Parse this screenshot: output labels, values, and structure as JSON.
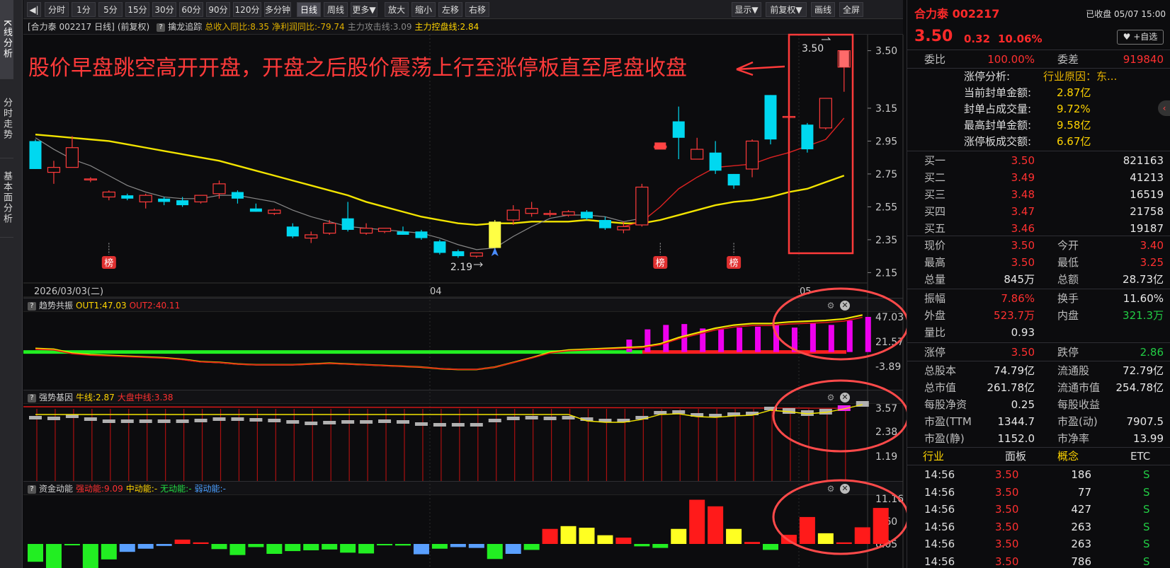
{
  "sidebar": [
    "K线分析",
    "分时走势",
    "基本面分析"
  ],
  "toolbar": {
    "period_buttons": [
      "分时",
      "1分",
      "5分",
      "15分",
      "30分",
      "60分",
      "90分",
      "120分",
      "多分钟",
      "日线",
      "周线",
      "更多▼",
      "放大",
      "缩小",
      "左移",
      "右移"
    ],
    "selected": "日线",
    "right_buttons": [
      "显示▼",
      "前复权▼",
      "画线",
      "全屏"
    ]
  },
  "status": {
    "name": "[合力泰 002217 日线]",
    "adj": "(前复权)",
    "indicator": "擒龙追踪",
    "items": [
      {
        "t": "总收入同比:8.35",
        "c": "#e0b000"
      },
      {
        "t": "净利润同比:-79.74",
        "c": "#e0b000"
      },
      {
        "t": "主力攻击线:3.09",
        "c": "#888888"
      },
      {
        "t": "主力控盘线:2.84",
        "c": "#ffd400"
      }
    ]
  },
  "annotation": "股价早盘跳空高开开盘，开盘之后股价震荡上行至涨停板直至尾盘收盘",
  "main_chart": {
    "y_ticks": [
      "3.50",
      "3.15",
      "2.95",
      "2.75",
      "2.55",
      "2.35",
      "2.15"
    ],
    "date_labels": [
      "2026/03/03(二)",
      "04",
      "05"
    ],
    "high_label": "3.50",
    "low_label": "2.19",
    "badge": "榜"
  },
  "panel1": {
    "name": "趋势共振",
    "items": [
      {
        "t": "OUT1:47.03",
        "c": "#ffd400"
      },
      {
        "t": "OUT2:40.11",
        "c": "#ff3030"
      }
    ],
    "ticks": [
      "47.03",
      "21.57",
      "-3.89"
    ]
  },
  "panel2": {
    "name": "强势基因",
    "items": [
      {
        "t": "牛线:2.87",
        "c": "#ffd400"
      },
      {
        "t": "大盘中线:3.38",
        "c": "#ff3030"
      }
    ],
    "ticks": [
      "3.57",
      "2.38",
      "1.19"
    ]
  },
  "panel3": {
    "name": "资金动能",
    "items": [
      {
        "t": "强动能:9.09",
        "c": "#ff3030"
      },
      {
        "t": "中动能:-",
        "c": "#ffd400"
      },
      {
        "t": "无动能:-",
        "c": "#22dd44"
      },
      {
        "t": "弱动能:-",
        "c": "#4a9fff"
      }
    ],
    "ticks": [
      "11.16",
      "5.60",
      "0.05"
    ]
  },
  "quote": {
    "name": "合力泰 002217",
    "state": "已收盘 05/07 15:00",
    "price": "3.50",
    "change": "0.32",
    "pct": "10.06%",
    "fav": "+自选",
    "weibi_label": "委比",
    "weibi": "100.00%",
    "weicha_label": "委差",
    "weicha": "919840",
    "limit": [
      {
        "l": "涨停分析:",
        "v": "行业原因：东..."
      },
      {
        "l": "当前封单金额:",
        "v": "2.87亿"
      },
      {
        "l": "封单占成交量:",
        "v": "9.72%"
      },
      {
        "l": "最高封单金额:",
        "v": "9.58亿"
      },
      {
        "l": "涨停板成交额:",
        "v": "6.67亿"
      }
    ],
    "bids": [
      {
        "l": "买一",
        "p": "3.50",
        "v": "821163"
      },
      {
        "l": "买二",
        "p": "3.49",
        "v": "41213"
      },
      {
        "l": "买三",
        "p": "3.48",
        "v": "16519"
      },
      {
        "l": "买四",
        "p": "3.47",
        "v": "21758"
      },
      {
        "l": "买五",
        "p": "3.46",
        "v": "19187"
      }
    ],
    "stats1": [
      {
        "l": "现价",
        "v": "3.50",
        "c": "red",
        "l2": "今开",
        "v2": "3.40",
        "c2": "red"
      },
      {
        "l": "最高",
        "v": "3.50",
        "c": "red",
        "l2": "最低",
        "v2": "3.25",
        "c2": "red"
      },
      {
        "l": "总量",
        "v": "845万",
        "c": "white",
        "l2": "总额",
        "v2": "28.73亿",
        "c2": "white"
      }
    ],
    "stats2": [
      {
        "l": "振幅",
        "v": "7.86%",
        "c": "red",
        "l2": "换手",
        "v2": "11.60%",
        "c2": "white"
      },
      {
        "l": "外盘",
        "v": "523.7万",
        "c": "red",
        "l2": "内盘",
        "v2": "321.3万",
        "c2": "green"
      },
      {
        "l": "量比",
        "v": "0.93",
        "c": "white",
        "l2": "",
        "v2": "",
        "c2": "white"
      }
    ],
    "stats3": [
      {
        "l": "涨停",
        "v": "3.50",
        "c": "red",
        "l2": "跌停",
        "v2": "2.86",
        "c2": "green"
      }
    ],
    "stats4": [
      {
        "l": "总股本",
        "v": "74.79亿",
        "c": "white",
        "l2": "流通股",
        "v2": "72.79亿",
        "c2": "white"
      },
      {
        "l": "总市值",
        "v": "261.78亿",
        "c": "white",
        "l2": "流通市值",
        "v2": "254.78亿",
        "c2": "white"
      },
      {
        "l": "每股净资",
        "v": "0.25",
        "c": "white",
        "l2": "每股收益",
        "v2": "",
        "c2": "white"
      },
      {
        "l": "市盈(TTM",
        "v": "1344.7",
        "c": "white",
        "l2": "市盈(动)",
        "v2": "7907.5",
        "c2": "white"
      },
      {
        "l": "市盈(静)",
        "v": "1152.0",
        "c": "white",
        "l2": "市净率",
        "v2": "13.99",
        "c2": "white"
      }
    ],
    "tabs": [
      "行业",
      "面板",
      "概念",
      "ETC"
    ],
    "ticks": [
      {
        "t": "14:56",
        "p": "3.50",
        "v": "186",
        "s": "S"
      },
      {
        "t": "14:56",
        "p": "3.50",
        "v": "77",
        "s": "S"
      },
      {
        "t": "14:56",
        "p": "3.50",
        "v": "427",
        "s": "S"
      },
      {
        "t": "14:56",
        "p": "3.50",
        "v": "263",
        "s": "S"
      },
      {
        "t": "14:56",
        "p": "3.50",
        "v": "263",
        "s": "S"
      },
      {
        "t": "14:56",
        "p": "3.50",
        "v": "786",
        "s": "S"
      }
    ]
  },
  "chart_data": {
    "type": "candlestick",
    "dates_shown": [
      "2026/03/03",
      "04",
      "05"
    ],
    "last_close": 3.5,
    "high_marker": 3.5,
    "low_marker": 2.19,
    "ohlc": [
      [
        2.95,
        2.78,
        2.96,
        2.78
      ],
      [
        2.76,
        2.79,
        2.83,
        2.69
      ],
      [
        2.79,
        2.91,
        2.98,
        2.79
      ],
      [
        2.72,
        2.72,
        2.73,
        2.7
      ],
      [
        2.61,
        2.64,
        2.65,
        2.59
      ],
      [
        2.62,
        2.6,
        2.63,
        2.59
      ],
      [
        2.58,
        2.62,
        2.63,
        2.54
      ],
      [
        2.6,
        2.58,
        2.61,
        2.56
      ],
      [
        2.59,
        2.56,
        2.61,
        2.55
      ],
      [
        2.58,
        2.62,
        2.62,
        2.57
      ],
      [
        2.63,
        2.69,
        2.71,
        2.6
      ],
      [
        2.64,
        2.6,
        2.65,
        2.57
      ],
      [
        2.54,
        2.52,
        2.57,
        2.52
      ],
      [
        2.51,
        2.53,
        2.54,
        2.5
      ],
      [
        2.43,
        2.37,
        2.45,
        2.36
      ],
      [
        2.36,
        2.38,
        2.4,
        2.33
      ],
      [
        2.39,
        2.45,
        2.47,
        2.38
      ],
      [
        2.48,
        2.41,
        2.58,
        2.4
      ],
      [
        2.39,
        2.42,
        2.45,
        2.38
      ],
      [
        2.4,
        2.42,
        2.42,
        2.39
      ],
      [
        2.4,
        2.38,
        2.43,
        2.38
      ],
      [
        2.4,
        2.36,
        2.41,
        2.35
      ],
      [
        2.34,
        2.27,
        2.35,
        2.26
      ],
      [
        2.28,
        2.25,
        2.29,
        2.24
      ],
      [
        2.25,
        2.27,
        2.27,
        2.24
      ],
      [
        2.46,
        2.3,
        2.47,
        2.29
      ],
      [
        2.47,
        2.53,
        2.56,
        2.44
      ],
      [
        2.51,
        2.54,
        2.58,
        2.49
      ],
      [
        2.51,
        2.51,
        2.53,
        2.49
      ],
      [
        2.5,
        2.52,
        2.53,
        2.49
      ],
      [
        2.52,
        2.48,
        2.53,
        2.47
      ],
      [
        2.47,
        2.42,
        2.49,
        2.41
      ],
      [
        2.41,
        2.43,
        2.46,
        2.39
      ],
      [
        2.44,
        2.67,
        2.69,
        2.43
      ],
      [
        2.91,
        2.92,
        2.92,
        2.9
      ],
      [
        3.07,
        2.97,
        3.16,
        2.84
      ],
      [
        2.84,
        2.9,
        2.97,
        2.84
      ],
      [
        2.88,
        2.77,
        2.95,
        2.75
      ],
      [
        2.75,
        2.68,
        2.75,
        2.66
      ],
      [
        2.78,
        2.95,
        2.96,
        2.73
      ],
      [
        3.23,
        2.96,
        3.23,
        2.93
      ],
      [
        3.1,
        3.1,
        3.1,
        3.1
      ],
      [
        3.05,
        2.9,
        3.06,
        2.88
      ],
      [
        3.03,
        3.21,
        3.21,
        3.02
      ],
      [
        3.4,
        3.5,
        3.5,
        3.25
      ]
    ],
    "panel1_bars": [
      21.5,
      33,
      38,
      39,
      34,
      33,
      35,
      36,
      38,
      35,
      40,
      38,
      43,
      47.03
    ],
    "panel3_values": [
      -4.5,
      -6.2,
      -0.2,
      -6.3,
      -3.9,
      -2,
      -1.2,
      -0.5,
      1.1,
      0.4,
      -1.3,
      -2.8,
      -0.8,
      -2.5,
      -1.8,
      -1.6,
      -1.4,
      -2.2,
      -2.4,
      -0.3,
      -0.4,
      -2.6,
      -1.2,
      -0.8,
      -1,
      -3.8,
      -2.5,
      -1.5,
      3.8,
      4.5,
      4.1,
      2.2,
      1.6,
      -0.6,
      -1,
      3.8,
      11.16,
      9.5,
      3.8,
      0.5,
      -1.5,
      2.3,
      6.8,
      2.7,
      0.4,
      4.2,
      9.09
    ]
  }
}
